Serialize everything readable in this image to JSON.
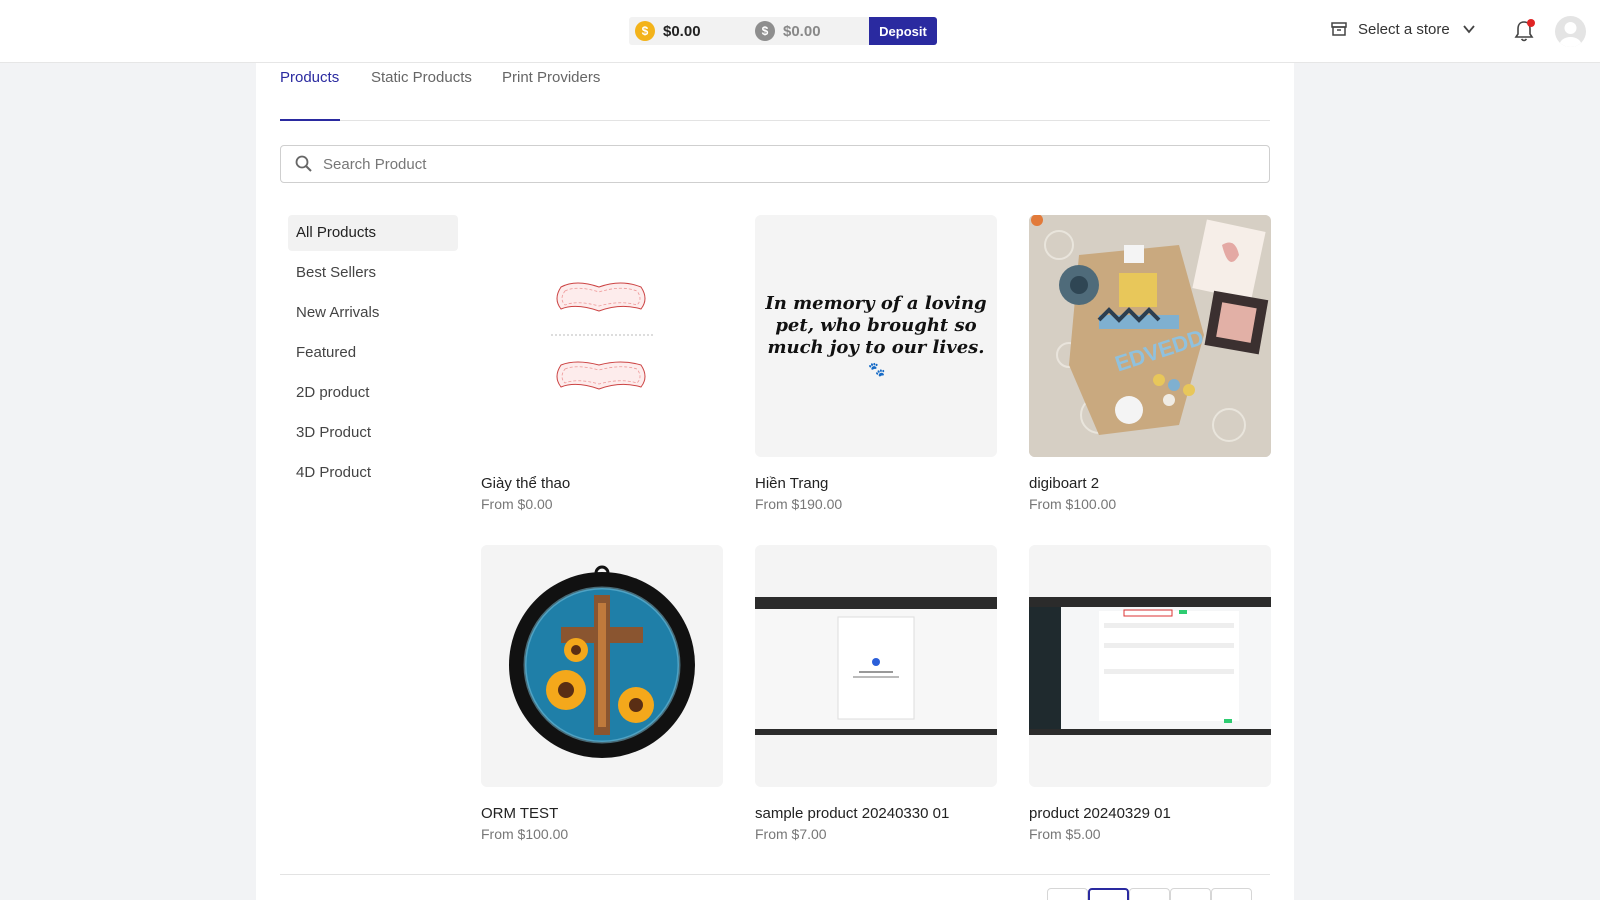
{
  "header": {
    "balance_primary": "$0.00",
    "balance_secondary": "$0.00",
    "deposit_label": "Deposit",
    "store_select_label": "Select a store",
    "icons": {
      "store": "store-icon",
      "chevron": "chevron-down-icon",
      "bell": "bell-icon",
      "avatar": "user-avatar-icon"
    }
  },
  "tabs": [
    {
      "label": "Products",
      "active": true
    },
    {
      "label": "Static Products",
      "active": false
    },
    {
      "label": "Print Providers",
      "active": false
    }
  ],
  "search": {
    "placeholder": "Search Product",
    "value": ""
  },
  "sidebar": {
    "items": [
      {
        "label": "All Products",
        "active": true
      },
      {
        "label": "Best Sellers"
      },
      {
        "label": "New Arrivals"
      },
      {
        "label": "Featured"
      },
      {
        "label": "2D product"
      },
      {
        "label": "3D Product"
      },
      {
        "label": "4D Product"
      }
    ]
  },
  "products": [
    {
      "name": "Giày thể thao",
      "price": "From $0.00"
    },
    {
      "name": "Hiền Trang",
      "price": "From $190.00",
      "image_text": "In memory of a loving pet, who brought so much joy to our lives."
    },
    {
      "name": "digiboart 2",
      "price": "From $100.00"
    },
    {
      "name": "ORM TEST",
      "price": "From $100.00"
    },
    {
      "name": "sample product 20240330 01",
      "price": "From $7.00"
    },
    {
      "name": "product 20240329 01",
      "price": "From $5.00"
    }
  ],
  "colors": {
    "accent": "#2a2aa0",
    "coin_gold": "#f3b31a",
    "notification": "#e02424"
  }
}
